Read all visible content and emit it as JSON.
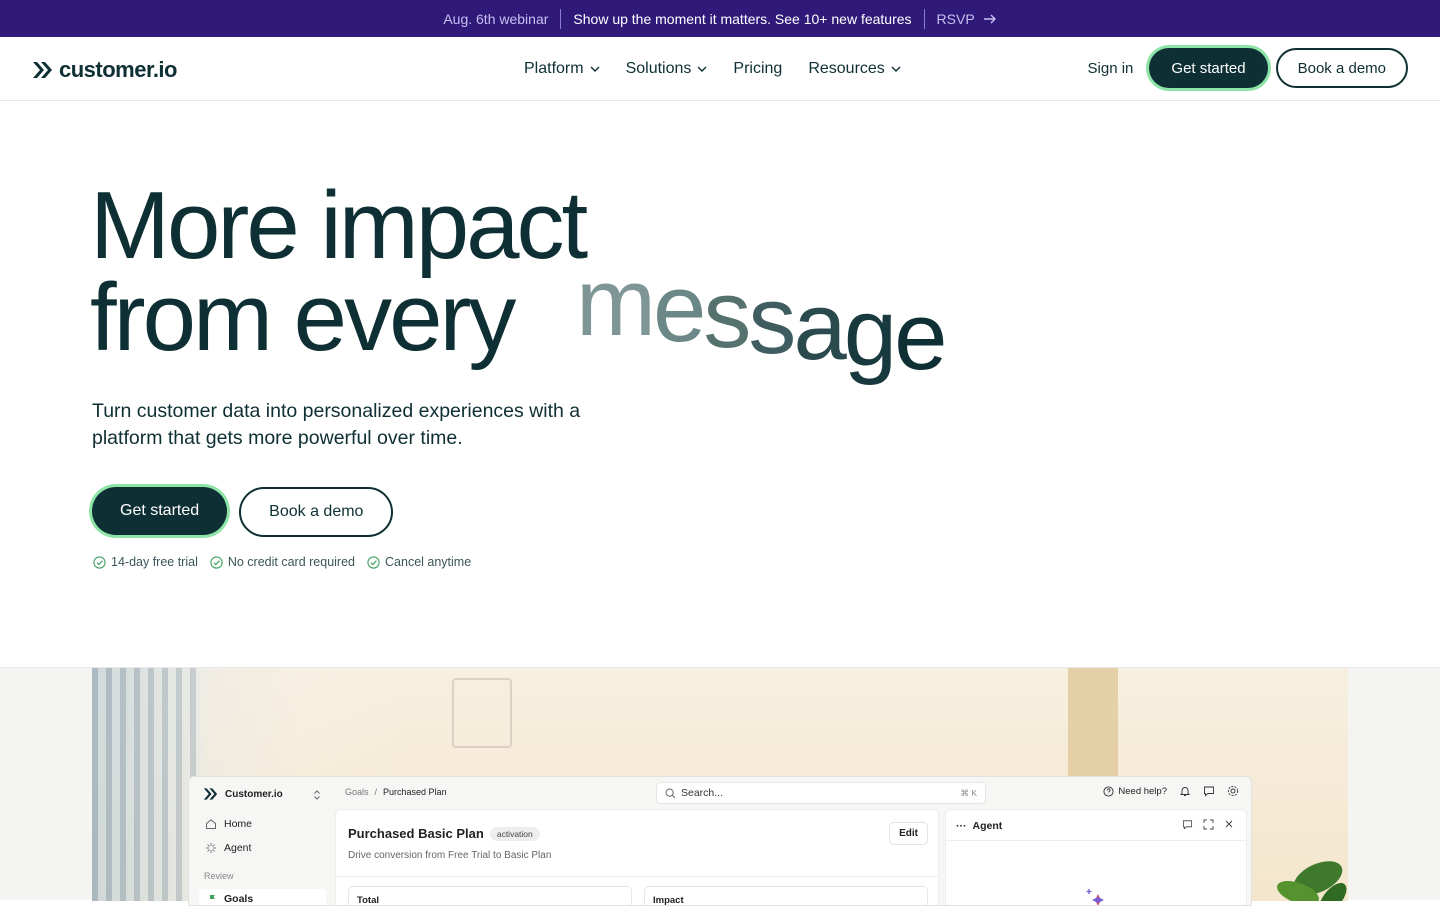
{
  "announcement": {
    "event": "Aug. 6th webinar",
    "message": "Show up the moment it matters. See 10+ new features",
    "cta": "RSVP",
    "colors": {
      "background": "#2f1a7a"
    }
  },
  "nav": {
    "logo_text": "customer.io",
    "menu": [
      {
        "label": "Platform",
        "has_dropdown": true
      },
      {
        "label": "Solutions",
        "has_dropdown": true
      },
      {
        "label": "Pricing",
        "has_dropdown": false
      },
      {
        "label": "Resources",
        "has_dropdown": true
      }
    ],
    "sign_in": "Sign in",
    "get_started": "Get started",
    "book_demo": "Book a demo"
  },
  "hero": {
    "title_line1": "More impact",
    "title_line2": "from every",
    "animated_word": [
      "m",
      "e",
      "s",
      "s",
      "a",
      "g",
      "e"
    ],
    "subtitle": "Turn customer data into personalized experiences with a platform that gets more powerful over time.",
    "cta_primary": "Get started",
    "cta_secondary": "Book a demo",
    "perks": [
      "14-day free trial",
      "No credit card required",
      "Cancel anytime"
    ],
    "colors": {
      "text": "#0e2f33",
      "accent_glow": "#8ee3a7",
      "perk_check": "#3fa05e"
    }
  },
  "app_preview": {
    "workspace": "Customer.io",
    "sidebar": [
      {
        "label": "Home",
        "icon": "home-icon"
      },
      {
        "label": "Agent",
        "icon": "sparkle-icon"
      }
    ],
    "sidebar_section": "Review",
    "sidebar_active": "Goals",
    "breadcrumbs": [
      "Goals",
      "Purchased Plan"
    ],
    "search_placeholder": "Search...",
    "search_shortcut": "⌘ K",
    "help_label": "Need help?",
    "goal": {
      "title": "Purchased Basic Plan",
      "tag": "activation",
      "description": "Drive conversion from Free Trial to Basic Plan",
      "edit_label": "Edit",
      "stats": [
        "Total",
        "Impact"
      ]
    },
    "agent_panel": {
      "title": "Agent"
    }
  }
}
